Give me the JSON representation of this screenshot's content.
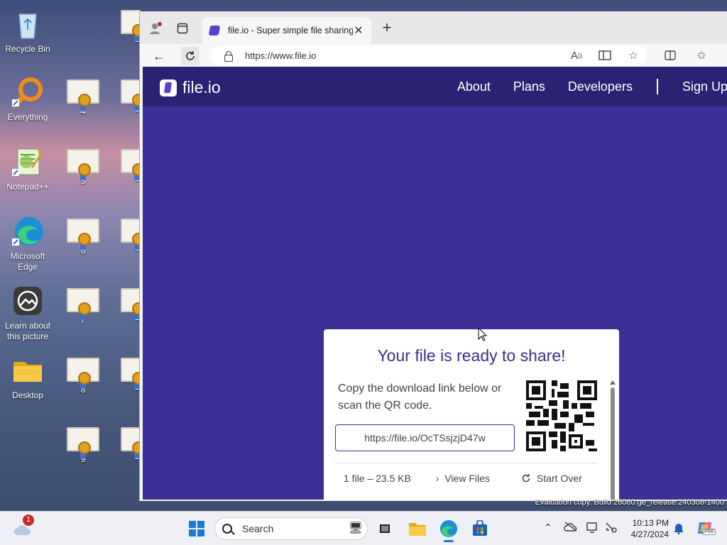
{
  "desktop": {
    "icons": [
      {
        "label": "Recycle Bin"
      },
      {
        "label": "Everything"
      },
      {
        "label": "Notepad++"
      },
      {
        "label": "Microsoft Edge"
      },
      {
        "label": "Learn about this picture"
      },
      {
        "label": "Desktop"
      }
    ],
    "certificates": [
      "4",
      "5",
      "6",
      "7",
      "8",
      "9"
    ],
    "partial_labels": [
      "1",
      "1",
      "1",
      "1",
      "1",
      "1",
      "1"
    ],
    "watermark": "Evaluation copy. Build 26080.ge_release.240308-1400"
  },
  "browser": {
    "tab_title": "file.io - Super simple file sharing",
    "url": "https://www.file.io"
  },
  "site": {
    "logo_text": "file.io",
    "nav": [
      "About",
      "Plans",
      "Developers",
      "Sign Up"
    ],
    "card": {
      "heading": "Your file is ready to share!",
      "desc": "Copy the download link below or scan the QR code.",
      "link": "https://file.io/OcTSsjzjD47w",
      "file_info": "1 file – 23.5 KB",
      "view_files": "View Files",
      "start_over": "Start Over"
    }
  },
  "taskbar": {
    "search_placeholder": "Search",
    "notification_count": "1",
    "time": "10:13 PM",
    "date": "4/27/2024",
    "copilot_badge": "PRE"
  }
}
